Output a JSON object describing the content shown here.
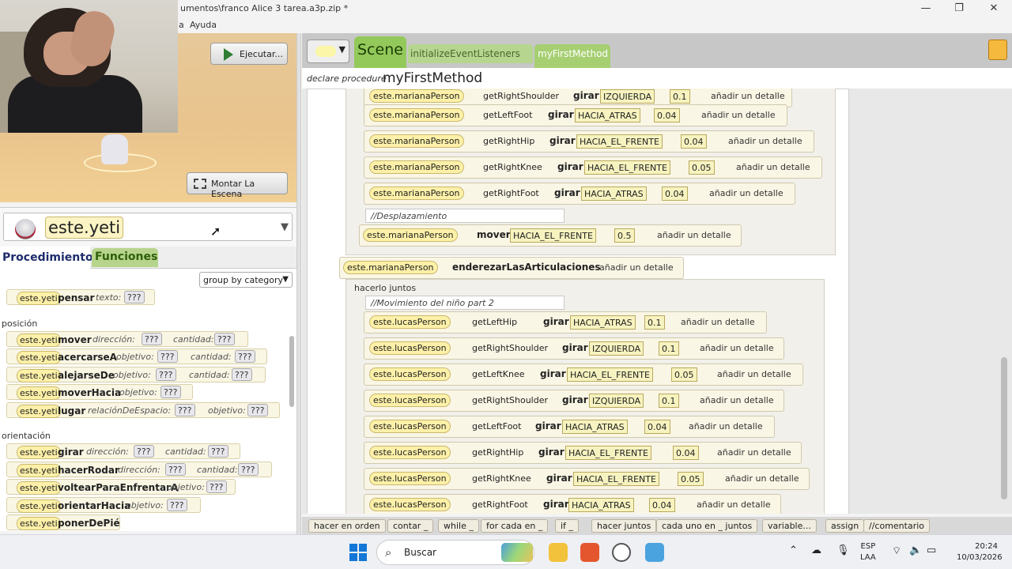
{
  "window": {
    "title": "umentos\\franco Alice 3 tarea.a3p.zip *",
    "minimize": "—",
    "restore": "❐",
    "close": "✕"
  },
  "menu": {
    "items": [
      "a",
      "Ayuda"
    ]
  },
  "scene": {
    "run_label": "Ejecutar...",
    "setup_label": "Montar La Escena"
  },
  "selector": {
    "selected": "este.yeti",
    "arrow": "▼"
  },
  "panel_tabs": {
    "procedures": "Procedimiento",
    "functions": "Funciones"
  },
  "method_list": {
    "group_by": "group by category",
    "top_row": {
      "obj": "este.yeti",
      "name": "pensar",
      "param": "texto:",
      "value": "???"
    },
    "categories": [
      {
        "label": "posición",
        "methods": [
          {
            "obj": "este.yeti",
            "name": "mover",
            "p1": "dirección:",
            "v1": "???",
            "p2": "cantidad:",
            "v2": "???"
          },
          {
            "obj": "este.yeti",
            "name": "acercarseA",
            "p1": "objetivo:",
            "v1": "???",
            "p2": "cantidad:",
            "v2": "???"
          },
          {
            "obj": "este.yeti",
            "name": "alejarseDe",
            "p1": "objetivo:",
            "v1": "???",
            "p2": "cantidad:",
            "v2": "???"
          },
          {
            "obj": "este.yeti",
            "name": "moverHacia",
            "p1": "objetivo:",
            "v1": "???"
          },
          {
            "obj": "este.yeti",
            "name": "lugar",
            "p1": "relaciónDeEspacio:",
            "v1": "???",
            "p2": "objetivo:",
            "v2": "???"
          }
        ]
      },
      {
        "label": "orientación",
        "methods": [
          {
            "obj": "este.yeti",
            "name": "girar",
            "p1": "dirección:",
            "v1": "???",
            "p2": "cantidad:",
            "v2": "???"
          },
          {
            "obj": "este.yeti",
            "name": "hacerRodar",
            "p1": "dirección:",
            "v1": "???",
            "p2": "cantidad:",
            "v2": "???"
          },
          {
            "obj": "este.yeti",
            "name": "voltearParaEnfrentarA",
            "p1": "objetivo:",
            "v1": "???"
          },
          {
            "obj": "este.yeti",
            "name": "orientarHacia",
            "p1": "objetivo:",
            "v1": "???"
          },
          {
            "obj": "este.yeti",
            "name": "ponerDePié"
          }
        ]
      }
    ]
  },
  "editor": {
    "tab_scene": "Scene",
    "tab_init": "initializeEventListeners",
    "tab_first": "myFirstMethod",
    "declare_label": "declare procedure",
    "proc_name": "myFirstMethod",
    "add_detail": "añadir un detalle",
    "upper_statements": [
      {
        "obj": "este.marianaPerson",
        "getter": "getRightShoulder",
        "verb": "girar",
        "dir": "IZQUIERDA",
        "num": "0.1"
      },
      {
        "obj": "este.marianaPerson",
        "getter": "getLeftFoot",
        "verb": "girar",
        "dir": "HACIA_ATRAS",
        "num": "0.04"
      },
      {
        "obj": "este.marianaPerson",
        "getter": "getRightHip",
        "verb": "girar",
        "dir": "HACIA_EL_FRENTE",
        "num": "0.04"
      },
      {
        "obj": "este.marianaPerson",
        "getter": "getRightKnee",
        "verb": "girar",
        "dir": "HACIA_EL_FRENTE",
        "num": "0.05"
      },
      {
        "obj": "este.marianaPerson",
        "getter": "getRightFoot",
        "verb": "girar",
        "dir": "HACIA_ATRAS",
        "num": "0.04"
      }
    ],
    "comment_1": "//Desplazamiento",
    "move_stmt": {
      "obj": "este.marianaPerson",
      "verb": "mover",
      "dir": "HACIA_EL_FRENTE",
      "num": "0.5"
    },
    "straighten_stmt": {
      "obj": "este.marianaPerson",
      "verb": "enderezarLasArticulaciones"
    },
    "do_together_label": "hacerlo juntos",
    "comment_2": "//Movimiento del niño part 2",
    "lower_statements": [
      {
        "obj": "este.lucasPerson",
        "getter": "getLeftHip",
        "verb": "girar",
        "dir": "HACIA_ATRAS",
        "num": "0.1"
      },
      {
        "obj": "este.lucasPerson",
        "getter": "getRightShoulder",
        "verb": "girar",
        "dir": "IZQUIERDA",
        "num": "0.1"
      },
      {
        "obj": "este.lucasPerson",
        "getter": "getLeftKnee",
        "verb": "girar",
        "dir": "HACIA_EL_FRENTE",
        "num": "0.05"
      },
      {
        "obj": "este.lucasPerson",
        "getter": "getRightShoulder",
        "verb": "girar",
        "dir": "IZQUIERDA",
        "num": "0.1"
      },
      {
        "obj": "este.lucasPerson",
        "getter": "getLeftFoot",
        "verb": "girar",
        "dir": "HACIA_ATRAS",
        "num": "0.04"
      },
      {
        "obj": "este.lucasPerson",
        "getter": "getRightHip",
        "verb": "girar",
        "dir": "HACIA_EL_FRENTE",
        "num": "0.04"
      },
      {
        "obj": "este.lucasPerson",
        "getter": "getRightKnee",
        "verb": "girar",
        "dir": "HACIA_EL_FRENTE",
        "num": "0.05"
      },
      {
        "obj": "este.lucasPerson",
        "getter": "getRightFoot",
        "verb": "girar",
        "dir": "HACIA_ATRAS",
        "num": "0.04"
      }
    ]
  },
  "control_bar": [
    "hacer en orden",
    "contar _",
    "while _",
    "for cada en _",
    "if _",
    "hacer juntos",
    "cada uno en _ juntos",
    "variable...",
    "assign",
    "//comentario"
  ],
  "taskbar": {
    "search_label": "Buscar",
    "lang_top": "ESP",
    "lang_bottom": "LAA",
    "time": "20:24",
    "date": "10/03/2026"
  },
  "colors": {
    "scene_tab": "#93c95a",
    "functions_tab": "#b7d48c",
    "object_tile": "#fdf0a8"
  }
}
